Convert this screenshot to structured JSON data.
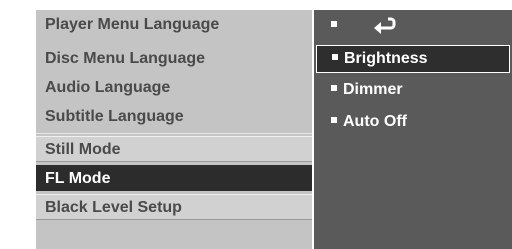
{
  "left_menu": {
    "items": [
      {
        "label": "Player Menu Language"
      },
      {
        "label": "Disc Menu Language"
      },
      {
        "label": "Audio Language"
      },
      {
        "label": "Subtitle Language"
      },
      {
        "label": "Still Mode"
      },
      {
        "label": "FL Mode"
      },
      {
        "label": "Black Level Setup"
      }
    ]
  },
  "sub_menu": {
    "return_icon": "return-arrow-icon",
    "items": [
      {
        "label": "Brightness"
      },
      {
        "label": "Dimmer"
      },
      {
        "label": "Auto Off"
      }
    ]
  },
  "colors": {
    "left_bg": "#c4c4c4",
    "right_bg": "#5a5a5a",
    "selected_bg": "#2c2c2c",
    "text_dark": "#4a4a4a",
    "text_light": "#ffffff"
  }
}
